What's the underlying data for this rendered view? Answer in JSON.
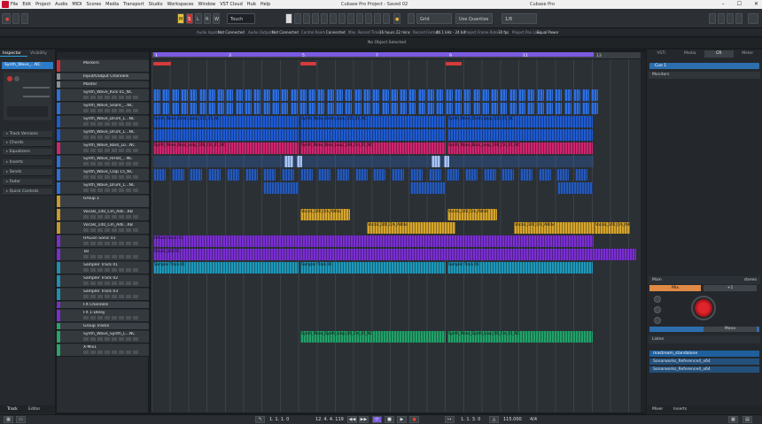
{
  "window": {
    "menu": [
      "File",
      "Edit",
      "Project",
      "Audio",
      "MIDI",
      "Scores",
      "Media",
      "Transport",
      "Studio",
      "Workspaces",
      "Window",
      "VST Cloud",
      "Hub",
      "Help"
    ],
    "title": "Cubase Pro Project - Saved 02",
    "app_title": "Cubase Pro"
  },
  "toolbar": {
    "m": "M",
    "s": "S",
    "l": "L",
    "r": "R",
    "w": "W",
    "automation_mode": "Touch",
    "snap": "Grid",
    "quantize_type": "Use Quantize",
    "quantize_value": "1/8",
    "colors_label": "●"
  },
  "status": {
    "audio_inputs_label": "Audio Inputs",
    "audio_inputs_value": "Not Connected",
    "audio_outputs_label": "Audio Outputs",
    "audio_outputs_value": "Not Connected",
    "control_room_label": "Control Room",
    "control_room_value": "Connected",
    "max_record_label": "Max. Record Time",
    "max_record_value": "16 hours 22 mins",
    "record_format_label": "Record Format",
    "record_format_value": "44.1 kHz - 24 bit",
    "frame_rate_label": "Project Frame Rate",
    "frame_rate_value": "30 fps",
    "pan_law_label": "Project Pan Law",
    "pan_law_value": "Equal Power"
  },
  "info_line": "No Object Selected",
  "inspector": {
    "tab_inspector": "Inspector",
    "tab_visibility": "Visibility",
    "track_name": "Synth_Wave_...NC",
    "sections": [
      "Track Versions",
      "Chords",
      "Equalizers",
      "Inserts",
      "Sends",
      "Fader",
      "Quick Controls"
    ],
    "bottom_track": "Track",
    "bottom_editor": "Editor"
  },
  "tracks": [
    {
      "name": "Markers",
      "color": "#c8303a",
      "type": "marker"
    },
    {
      "name": "Input/Output Channels",
      "color": "#8a9096",
      "type": "folder"
    },
    {
      "name": "Master",
      "color": "#8a9096",
      "type": "track"
    },
    {
      "name": "Synth_Wave_Kick 01_NC",
      "color": "#2d6fdc",
      "type": "track"
    },
    {
      "name": "Synth_Wave_Snare_...NC",
      "color": "#2d6fdc",
      "type": "track"
    },
    {
      "name": "Synth_Wave_Drum_L...NC",
      "color": "#1f5bd1",
      "type": "track"
    },
    {
      "name": "Synth_Wave_Drum_L...NC",
      "color": "#1f5bd1",
      "type": "track"
    },
    {
      "name": "Synth_Wave_Bass_Lo...NC",
      "color": "#d0266e",
      "type": "track"
    },
    {
      "name": "Synth_Wave_HiHat_...NC",
      "color": "#2d6fdc",
      "type": "track"
    },
    {
      "name": "Synth_Wave_Clap 15_NC",
      "color": "#2d6fdc",
      "type": "track"
    },
    {
      "name": "Synth_Wave_Drum_L...NC",
      "color": "#2d6fdc",
      "type": "track"
    },
    {
      "name": "Group 1",
      "color": "#c89a2a",
      "type": "folder"
    },
    {
      "name": "Vocals_140_Cm_Adli...KB",
      "color": "#c89a2a",
      "type": "track"
    },
    {
      "name": "Vocals_140_Cm_Adli...KB",
      "color": "#c89a2a",
      "type": "track"
    },
    {
      "name": "HALion Sonic 01",
      "color": "#7c2fd0",
      "type": "track"
    },
    {
      "name": "Tal",
      "color": "#7c2fd0",
      "type": "track"
    },
    {
      "name": "Sampler Track 01",
      "color": "#1f8fb0",
      "type": "track"
    },
    {
      "name": "Sampler Track 02",
      "color": "#1f8fb0",
      "type": "track"
    },
    {
      "name": "Sampler Track 03",
      "color": "#1f8fb0",
      "type": "track"
    },
    {
      "name": "FX Channels",
      "color": "#7c2fd0",
      "type": "folder"
    },
    {
      "name": "FX 1-Delay",
      "color": "#7c2fd0",
      "type": "track"
    },
    {
      "name": "Group Tracks",
      "color": "#2aa36a",
      "type": "folder"
    },
    {
      "name": "Synth_Wave_Synth_L...NC",
      "color": "#2aa36a",
      "type": "track"
    },
    {
      "name": "X-Mix1",
      "color": "#2aa36a",
      "type": "track"
    }
  ],
  "ruler": [
    "1",
    "3",
    "5",
    "7",
    "9",
    "11",
    "13"
  ],
  "markers": [
    "Marker1",
    "Marker2",
    "Marker3"
  ],
  "events": {
    "drum_loop": "Synth_Wave_Drum_Loop_115_01_NC",
    "bass_loop": "Synth_Wave_Bass_Loop_108_Cm_01_NC",
    "vocal_adlib": "Vocals_140_Cm_Adlibs",
    "halion": "HALion Sonic 01",
    "tal": "Vocals_a04 01",
    "sampler": "Sampler Track 01",
    "synth": "Synth_Wave_Synth_Loop_08_Cm_01_NC"
  },
  "right_zone": {
    "tabs": [
      "VSTi",
      "Media",
      "CR",
      "Meter"
    ],
    "cr_selected": "Cue 1",
    "monitors": "Monitors",
    "main": "Main",
    "main_right": "stereo",
    "mix": "Mix",
    "mix2": "+1",
    "mono_label": "Mono",
    "listen": "Listen",
    "listen_items": [
      "mastream_standalone",
      "Sonarworks_Reference4_x64",
      "Sonarworks_Reference4_x64"
    ],
    "bottom_mixer": "Mixer",
    "bottom_inserts": "Inserts"
  },
  "transport": {
    "left_locator": "1. 1. 1. 0",
    "position": "12. 4. 4. 119",
    "right_locator": "1. 1. 3. 0",
    "tempo": "115.000",
    "signature": "4/4"
  }
}
